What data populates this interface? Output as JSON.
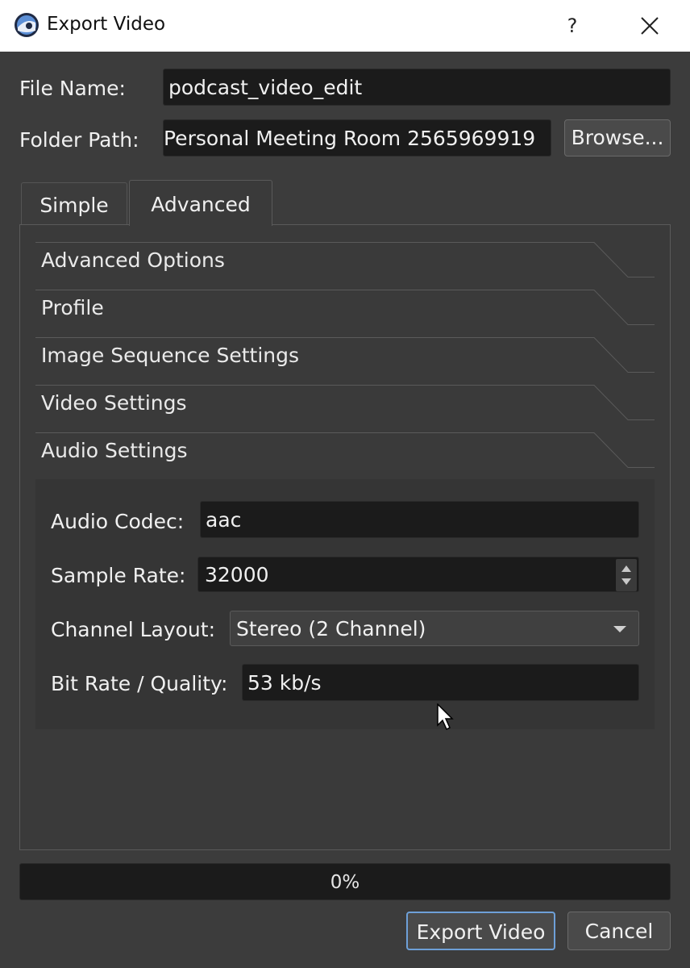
{
  "window": {
    "title": "Export Video",
    "help_label": "?",
    "icons": [
      "app-logo-icon",
      "close-icon"
    ]
  },
  "file": {
    "name_label": "File Name:",
    "name_value": "podcast_video_edit",
    "folder_label": "Folder Path:",
    "folder_value": "Personal Meeting Room 2565969919",
    "browse_label": "Browse..."
  },
  "tabs": [
    {
      "label": "Simple",
      "selected": false
    },
    {
      "label": "Advanced",
      "selected": true
    }
  ],
  "sections": [
    {
      "label": "Advanced Options"
    },
    {
      "label": "Profile"
    },
    {
      "label": "Image Sequence Settings"
    },
    {
      "label": "Video Settings"
    },
    {
      "label": "Audio Settings"
    }
  ],
  "audio": {
    "codec_label": "Audio Codec:",
    "codec_value": "aac",
    "sample_rate_label": "Sample Rate:",
    "sample_rate_value": "32000",
    "channel_layout_label": "Channel Layout:",
    "channel_layout_value": "Stereo (2 Channel)",
    "bitrate_label": "Bit Rate / Quality:",
    "bitrate_value": "53 kb/s"
  },
  "progress": {
    "text": "0%",
    "fraction": 0
  },
  "buttons": {
    "export_label": "Export Video",
    "cancel_label": "Cancel"
  },
  "colors": {
    "background": "#3c3c3c",
    "field": "#1b1b1b",
    "focus_border": "#6ea0d8"
  }
}
